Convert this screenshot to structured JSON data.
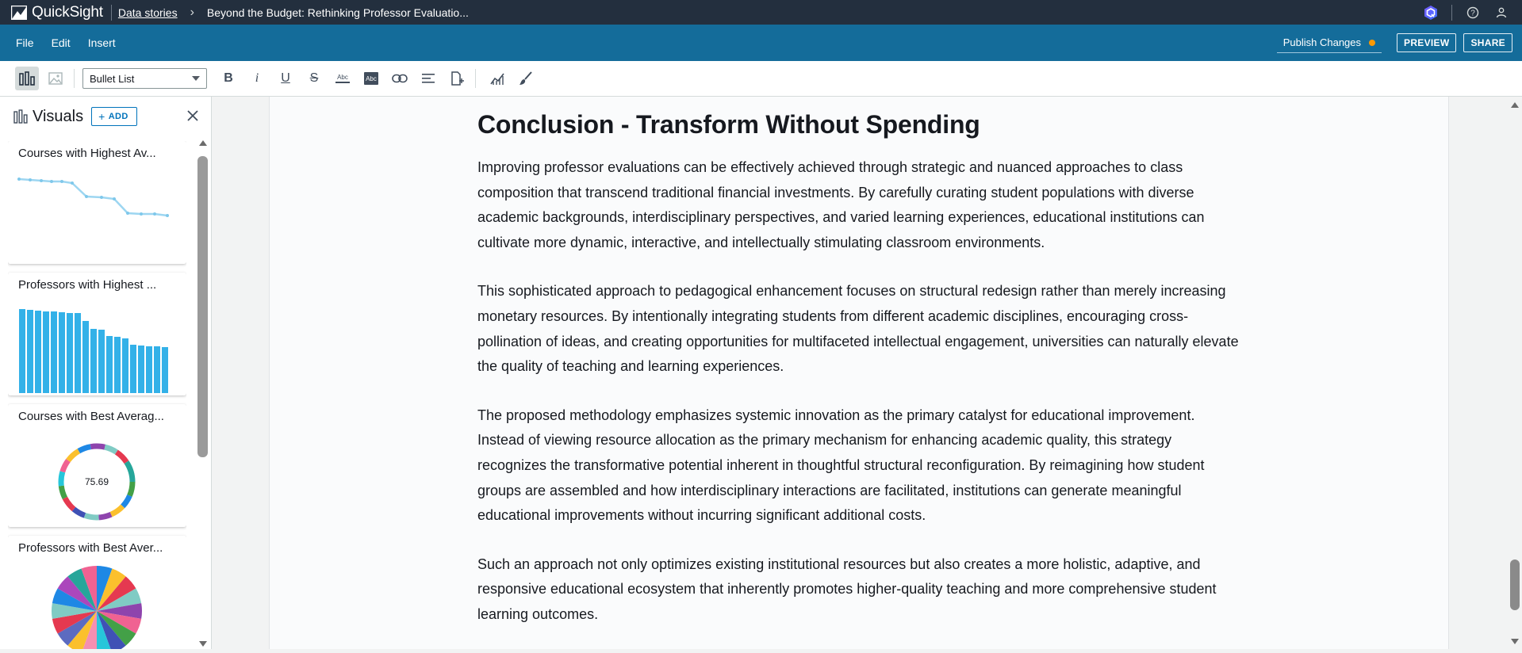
{
  "topbar": {
    "app_name": "QuickSight",
    "breadcrumb_link": "Data stories",
    "breadcrumb_current": "Beyond the Budget: Rethinking Professor Evaluatio..."
  },
  "menu": {
    "items": [
      "File",
      "Edit",
      "Insert"
    ],
    "publish_label": "Publish Changes",
    "preview_label": "PREVIEW",
    "share_label": "SHARE"
  },
  "toolbar": {
    "text_style": "Bullet List"
  },
  "visuals_panel": {
    "title": "Visuals",
    "add_label": "ADD",
    "cards": [
      {
        "title": "Courses with Highest Av...",
        "type": "line"
      },
      {
        "title": "Professors with Highest ...",
        "type": "bar"
      },
      {
        "title": "Courses with Best Averag...",
        "type": "donut",
        "center_value": "75.69"
      },
      {
        "title": "Professors with Best Aver...",
        "type": "pie"
      }
    ]
  },
  "story": {
    "heading": "Conclusion - Transform Without Spending",
    "paragraphs": [
      "Improving professor evaluations can be effectively achieved through strategic and nuanced approaches to class composition that transcend traditional financial investments. By carefully curating student populations with diverse academic backgrounds, interdisciplinary perspectives, and varied learning experiences, educational institutions can cultivate more dynamic, interactive, and intellectually stimulating classroom environments.",
      "This sophisticated approach to pedagogical enhancement focuses on structural redesign rather than merely increasing monetary resources. By intentionally integrating students from different academic disciplines, encouraging cross-pollination of ideas, and creating opportunities for multifaceted intellectual engagement, universities can naturally elevate the quality of teaching and learning experiences.",
      "The proposed methodology emphasizes systemic innovation as the primary catalyst for educational improvement. Instead of viewing resource allocation as the primary mechanism for enhancing academic quality, this strategy recognizes the transformative potential inherent in thoughtful structural reconfiguration. By reimagining how student groups are assembled and how interdisciplinary interactions are facilitated, institutions can generate meaningful educational improvements without incurring significant additional costs.",
      "Such an approach not only optimizes existing institutional resources but also creates a more holistic, adaptive, and responsive educational ecosystem that inherently promotes higher-quality teaching and more comprehensive student learning outcomes."
    ]
  },
  "colors": {
    "topbar": "#232f3e",
    "menubar": "#146c9a",
    "accent": "#0073bb",
    "publish_dot": "#ff9900",
    "chart_blue": "#33b1e8"
  }
}
